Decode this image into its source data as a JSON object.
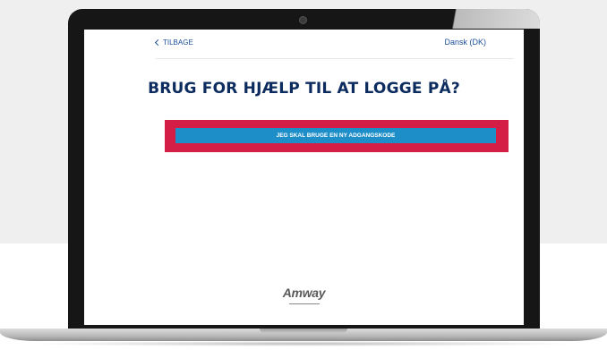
{
  "nav": {
    "back_label": "TILBAGE",
    "language_label": "Dansk (DK)"
  },
  "main": {
    "heading": "BRUG FOR HJÆLP TIL AT LOGGE PÅ?",
    "new_password_button_label": "JEG SKAL BRUGE EN NY ADGANGSKODE"
  },
  "footer": {
    "logo_text": "Amway"
  },
  "colors": {
    "heading": "#0c2b5e",
    "link": "#1c4e9b",
    "button": "#1e8ec9",
    "highlight": "#d41e45"
  },
  "icons": {
    "back": "chevron-left-icon"
  }
}
